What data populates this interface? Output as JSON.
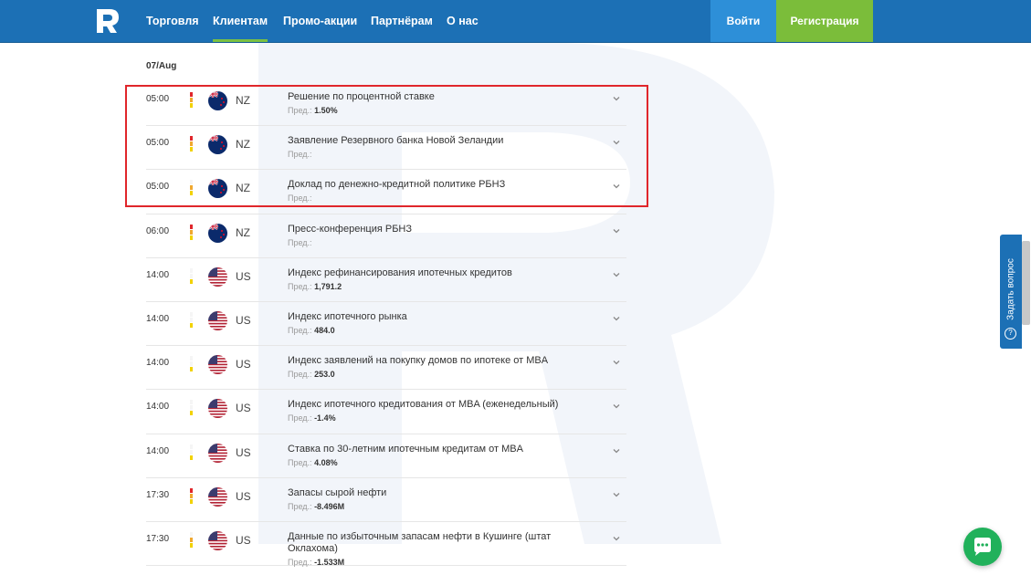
{
  "header": {
    "nav": [
      {
        "label": "Торговля",
        "active": false
      },
      {
        "label": "Клиентам",
        "active": true
      },
      {
        "label": "Промо-акции",
        "active": false
      },
      {
        "label": "Партнёрам",
        "active": false
      },
      {
        "label": "О нас",
        "active": false
      }
    ],
    "login_label": "Войти",
    "register_label": "Регистрация"
  },
  "calendar": {
    "date": "07/Aug",
    "prev_label": "Пред.:",
    "events": [
      {
        "time": "05:00",
        "country": "NZ",
        "title": "Решение по процентной ставке",
        "prev": "1.50%",
        "impact": "high"
      },
      {
        "time": "05:00",
        "country": "NZ",
        "title": "Заявление Резервного банка Новой Зеландии",
        "prev": "",
        "impact": "high"
      },
      {
        "time": "05:00",
        "country": "NZ",
        "title": "Доклад по денежно-кредитной политике РБНЗ",
        "prev": "",
        "impact": "medium"
      },
      {
        "time": "06:00",
        "country": "NZ",
        "title": "Пресс-конференция РБНЗ",
        "prev": "",
        "impact": "high"
      },
      {
        "time": "14:00",
        "country": "US",
        "title": "Индекс рефинансирования ипотечных кредитов",
        "prev": "1,791.2",
        "impact": "low"
      },
      {
        "time": "14:00",
        "country": "US",
        "title": "Индекс ипотечного рынка",
        "prev": "484.0",
        "impact": "low"
      },
      {
        "time": "14:00",
        "country": "US",
        "title": "Индекс заявлений на покупку домов по ипотеке от MBA",
        "prev": "253.0",
        "impact": "low"
      },
      {
        "time": "14:00",
        "country": "US",
        "title": "Индекс ипотечного кредитования от MBA (еженедельный)",
        "prev": "-1.4%",
        "impact": "low"
      },
      {
        "time": "14:00",
        "country": "US",
        "title": "Ставка по 30-летним ипотечным кредитам от MBA",
        "prev": "4.08%",
        "impact": "low"
      },
      {
        "time": "17:30",
        "country": "US",
        "title": "Запасы сырой нефти",
        "prev": "-8.496M",
        "impact": "high"
      },
      {
        "time": "17:30",
        "country": "US",
        "title": "Данные по избыточным запасам нефти в Кушинге (штат Оклахома)",
        "prev": "-1.533M",
        "impact": "medium"
      }
    ]
  },
  "side_tab": {
    "label": "Задать вопрос",
    "icon": "question-circle-icon"
  },
  "chat": {
    "icon": "chat-bubble-icon"
  },
  "colors": {
    "header_bg": "#1c70b5",
    "login_bg": "#2d8fd8",
    "register_bg": "#7bbd3a",
    "highlight": "#e0262b",
    "impact_high": "#e0262b",
    "impact_medium": "#f0a830",
    "impact_low": "#f2d200",
    "chat_bg": "#21b15b"
  }
}
